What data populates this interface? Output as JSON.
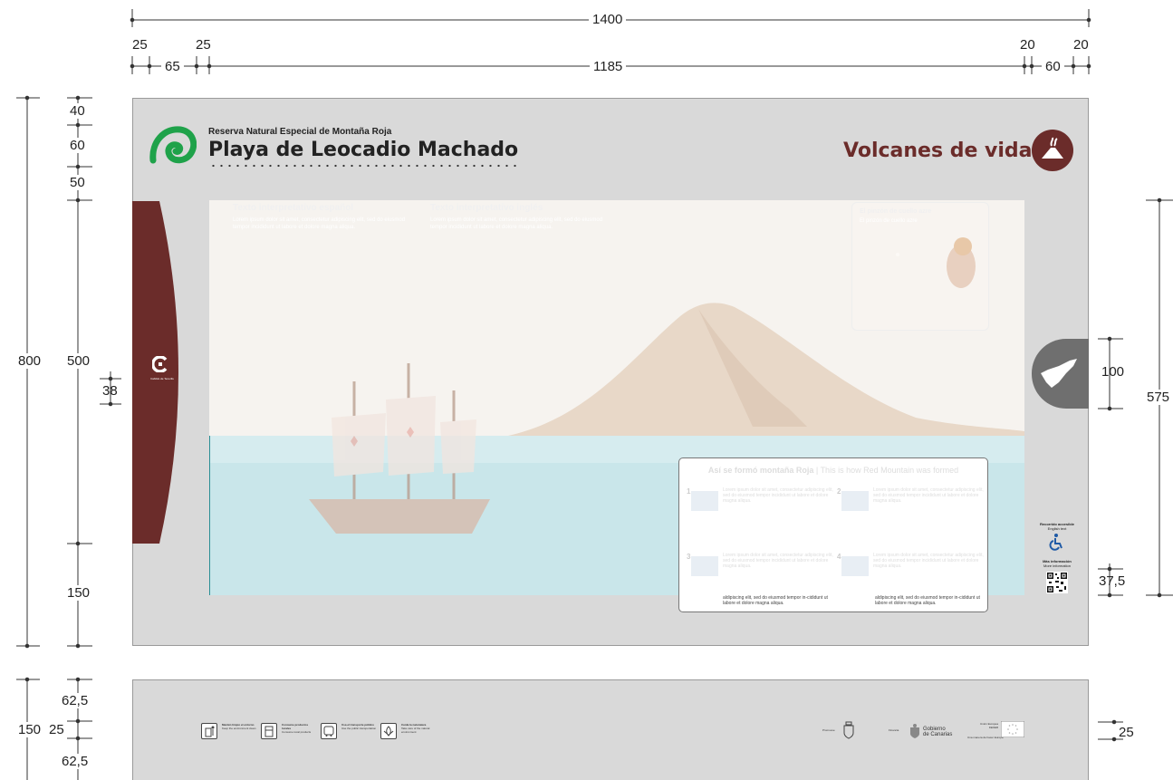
{
  "dimensions": {
    "total_width": "1400",
    "margin_left_a": "25",
    "margin_left_b": "25",
    "margin_left_c": "65",
    "content_width": "1185",
    "margin_right_a": "20",
    "margin_right_b": "20",
    "margin_right_c": "60",
    "height_total": "800",
    "header_40": "40",
    "header_60": "60",
    "header_50": "50",
    "mid_500": "500",
    "band_38": "38",
    "bottom_150": "150",
    "right_575": "575",
    "tab_100": "100",
    "qr_37_5": "37,5",
    "strip_150": "150",
    "strip_25_left": "25",
    "strip_62_5_top": "62,5",
    "strip_62_5_bottom": "62,5",
    "strip_25_right": "25"
  },
  "header": {
    "subtitle": "Reserva Natural Especial de Montaña Roja",
    "title": "Playa de Leocadio Machado",
    "theme": "Volcanes de vida"
  },
  "scene": {
    "text_es_title": "Texto interpretativo español",
    "text_en_title": "Texto interpretativo inglés",
    "bird_title": "El pinzón de cuello azre",
    "bird_subtitle": "El pinzón de cuello azre",
    "formed_title_es": "Así se formó montaña Roja",
    "formed_title_en": "This is how Red Mountain was formed",
    "step_text": "aldipiscing elit, sed do eiusmod tempor in-cididunt ut labore et dolore magna aliqua.",
    "steps": [
      "1",
      "2",
      "3",
      "4"
    ],
    "lorem": "Lorem ipsum dolor sit amet, consectetur adipiscing elit, sed do eiusmod tempor incididunt ut labore et dolore magna aliqua."
  },
  "side": {
    "tenerife": "TENERIFE",
    "accessible_title": "Recorrido accesible",
    "accessible_sub": "English text",
    "info_title": "Más información",
    "info_sub": "More information"
  },
  "bottom_strip": {
    "items": [
      {
        "label": "Mantén limpio el entorno",
        "sub": "Keep the environment clean",
        "icon": "trash-bin-icon"
      },
      {
        "label": "Consume productos locales",
        "sub": "Consume local products",
        "icon": "local-product-icon"
      },
      {
        "label": "Usa el transporte público",
        "sub": "Use the public transportation",
        "icon": "bus-icon"
      },
      {
        "label": "Cuida la naturaleza",
        "sub": "Take care of the natural environment",
        "icon": "nature-icon"
      }
    ],
    "promueve": "Promueve",
    "financia": "Financia",
    "gobierno_a": "Gobierno",
    "gobierno_b": "de Canarias",
    "eu_a": "Unión Europea",
    "eu_b": "FEDER",
    "eu_slogan": "Una manera de hacer Europa"
  },
  "colors": {
    "brand": "#6b2c2a",
    "panel": "#d9d9d9",
    "tab": "#6f6f6f",
    "sea": "#b8dde3",
    "logo_green": "#1fa24a"
  }
}
